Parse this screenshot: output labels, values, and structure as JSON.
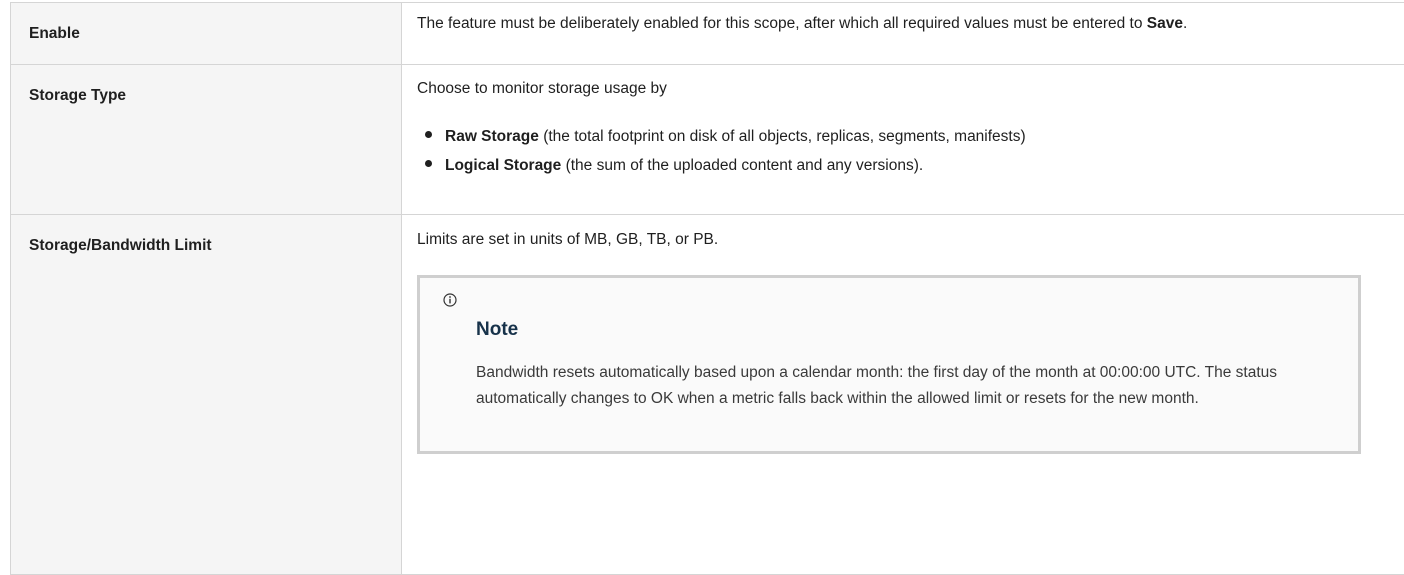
{
  "rows": [
    {
      "key": "Enable",
      "desc_parts": [
        "The feature must be deliberately enabled for this scope, after which all required values must be entered to ",
        "Save",
        "."
      ]
    },
    {
      "key": "Storage Type",
      "intro": "Choose to monitor storage usage by",
      "options": [
        {
          "term": "Raw Storage",
          "detail": " (the total footprint on disk of all objects, replicas, segments, manifests)"
        },
        {
          "term": "Logical Storage",
          "detail": " (the sum of the uploaded content and any versions)."
        }
      ]
    },
    {
      "key": "Storage/Bandwidth Limit",
      "intro": "Limits are set in units of MB, GB, TB, or PB.",
      "note": {
        "icon": "info-icon",
        "title": "Note",
        "body": "Bandwidth resets automatically based upon a calendar month: the first day of the month at 00:00:00 UTC. The status automatically changes to OK when a metric falls back within the allowed limit or resets for the new month."
      }
    }
  ]
}
